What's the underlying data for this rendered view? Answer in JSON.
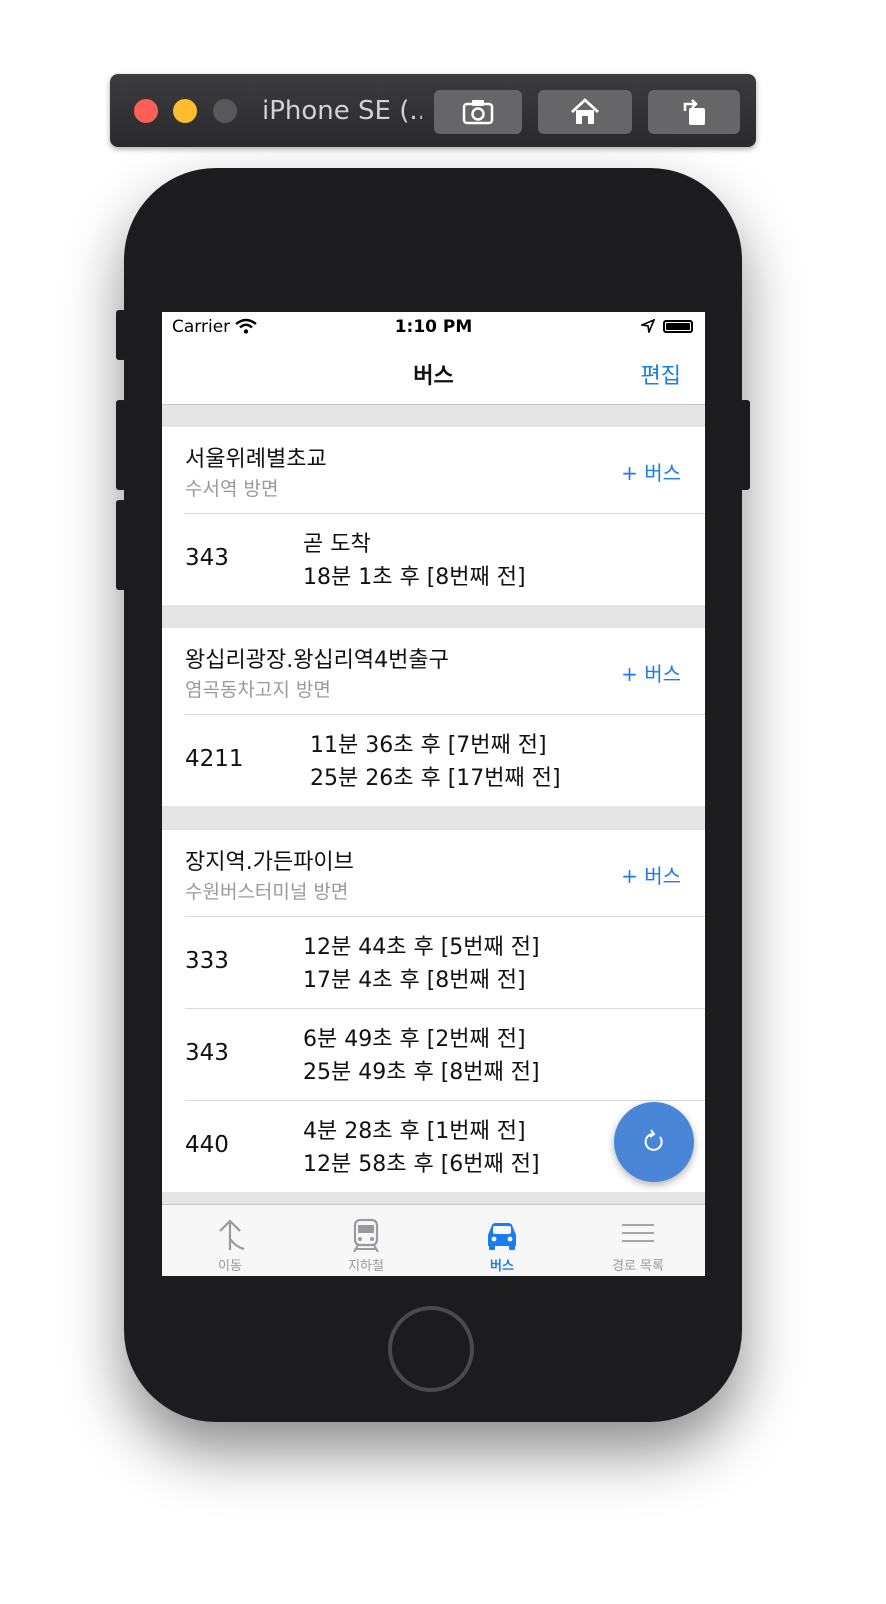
{
  "simulator": {
    "title": "iPhone SE (..."
  },
  "status_bar": {
    "carrier": "Carrier",
    "time": "1:10 PM"
  },
  "nav": {
    "title": "버스",
    "edit_label": "편집"
  },
  "stops": [
    {
      "name": "서울위례별초교",
      "direction": "수서역 방면",
      "add_label": "+ 버스",
      "routes": [
        {
          "number": "343",
          "line1": "곧 도착",
          "line2": "18분 1초 후 [8번째 전]"
        }
      ]
    },
    {
      "name": "왕십리광장.왕십리역4번출구",
      "direction": "염곡동차고지 방면",
      "add_label": "+ 버스",
      "routes": [
        {
          "number": "4211",
          "line1": "11분 36초 후 [7번째 전]",
          "line2": "25분 26초 후 [17번째 전]"
        }
      ]
    },
    {
      "name": "장지역.가든파이브",
      "direction": "수원버스터미널 방면",
      "add_label": "+ 버스",
      "routes": [
        {
          "number": "333",
          "line1": "12분 44초 후 [5번째 전]",
          "line2": "17분 4초 후 [8번째 전]"
        },
        {
          "number": "343",
          "line1": "6분 49초 후 [2번째 전]",
          "line2": "25분 49초 후 [8번째 전]"
        },
        {
          "number": "440",
          "line1": "4분 28초 후 [1번째 전]",
          "line2": "12분 58초 후 [6번째 전]"
        }
      ]
    }
  ],
  "tabs": [
    {
      "label": "이동",
      "icon": "move-icon"
    },
    {
      "label": "지하철",
      "icon": "subway-icon"
    },
    {
      "label": "버스",
      "icon": "bus-icon",
      "active": true
    },
    {
      "label": "경로 목록",
      "icon": "list-icon"
    }
  ],
  "colors": {
    "accent": "#1a7bf2",
    "fab": "#4a86d8"
  }
}
